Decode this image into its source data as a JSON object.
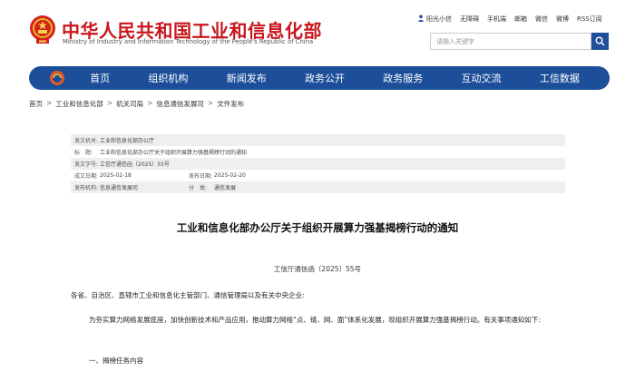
{
  "header": {
    "title": "中华人民共和国工业和信息化部",
    "subtitle": "Ministry of Industry and Information Technology of the People's Republic of China",
    "top_links": [
      "阳光小信",
      "无障碍",
      "手机端",
      "邮箱",
      "微信",
      "微博",
      "RSS订阅"
    ],
    "search_placeholder": "请输入关键字"
  },
  "nav": {
    "items": [
      "首页",
      "组织机构",
      "新闻发布",
      "政务公开",
      "政务服务",
      "互动交流",
      "工信数据"
    ]
  },
  "breadcrumb": [
    "首页",
    "工业和信息化部",
    "机关司局",
    "信息通信发展司",
    "文件发布"
  ],
  "breadcrumb_sep": ">",
  "info": {
    "issuer_label": "发文机关:",
    "issuer": "工业和信息化部办公厅",
    "title_label": "标　题:",
    "title": "工业和信息化部办公厅关于组织开展算力强基揭榜行动的通知",
    "docno_label": "发文字号:",
    "docno": "工信厅通信函〔2025〕55号",
    "created_label": "成文日期:",
    "created": "2025-02-18",
    "published_label": "发布日期:",
    "published": "2025-02-20",
    "publisher_label": "发布机构:",
    "publisher": "信息通信发展司",
    "category_label": "分　类:",
    "category": "通信发展"
  },
  "article": {
    "title": "工业和信息化部办公厅关于组织开展算力强基揭榜行动的通知",
    "doc_number": "工信厅通信函〔2025〕55号",
    "salutation": "各省、自治区、直辖市工业和信息化主管部门、通信管理局以及有关中央企业:",
    "paragraph1": "为夯实算力网络发展底座，加快创新技术和产品应用，推动算力网络“点、链、网、面”体系化发展，现组织开展算力强基揭榜行动。有关事项通知如下:",
    "section1": "一、揭榜任务内容"
  },
  "colors": {
    "brand_red": "#c8161d",
    "nav_blue": "#1d4e9a"
  }
}
